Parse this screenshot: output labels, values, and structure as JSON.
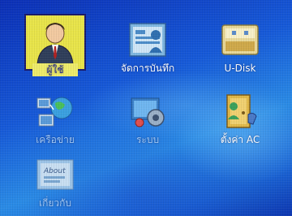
{
  "menu": {
    "items": [
      {
        "label": "ผู้ใช้",
        "icon": "user-icon",
        "selected": true
      },
      {
        "label": "จัดการบันทึก",
        "icon": "record-management-icon"
      },
      {
        "label": "U-Disk",
        "icon": "usb-disk-icon"
      },
      {
        "label": "เครือข่าย",
        "icon": "network-icon"
      },
      {
        "label": "ระบบ",
        "icon": "system-icon"
      },
      {
        "label": "ตั้งค่า AC",
        "icon": "access-control-settings-icon"
      },
      {
        "label": "เกี่ยวกับ",
        "icon": "about-icon"
      }
    ],
    "about_icon_text": "About"
  },
  "colors": {
    "highlight": "#e8e44a",
    "background": "#1659d8"
  }
}
